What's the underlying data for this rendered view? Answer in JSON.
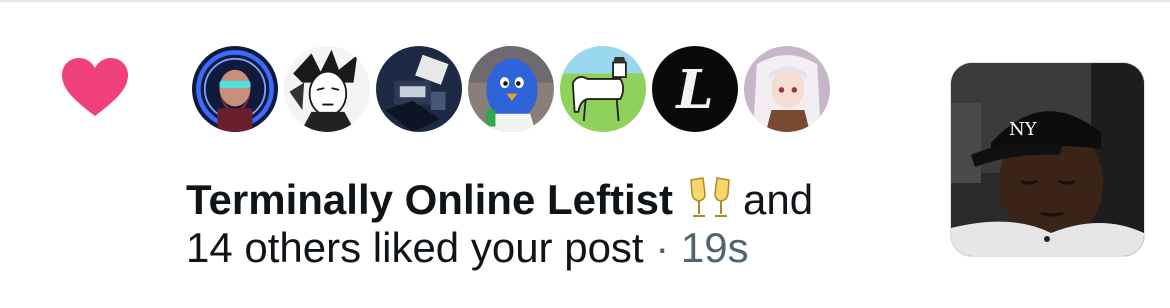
{
  "notification": {
    "type": "like",
    "actor_name": "Terminally Online Leftist",
    "actor_emoji": "🥂",
    "text_connector": "and",
    "text_rest": "14 others liked your post",
    "separator": "·",
    "timestamp": "19s"
  },
  "avatars": [
    {
      "name": "avatar-1"
    },
    {
      "name": "avatar-2"
    },
    {
      "name": "avatar-3"
    },
    {
      "name": "avatar-4"
    },
    {
      "name": "avatar-5"
    },
    {
      "name": "avatar-6",
      "letter": "L"
    },
    {
      "name": "avatar-7"
    }
  ],
  "colors": {
    "heart": "#f0407e",
    "text_primary": "#0f1419",
    "text_secondary": "#536471"
  },
  "icons": {
    "like": "heart-icon",
    "actor_emoji": "champagne-glasses-icon"
  }
}
